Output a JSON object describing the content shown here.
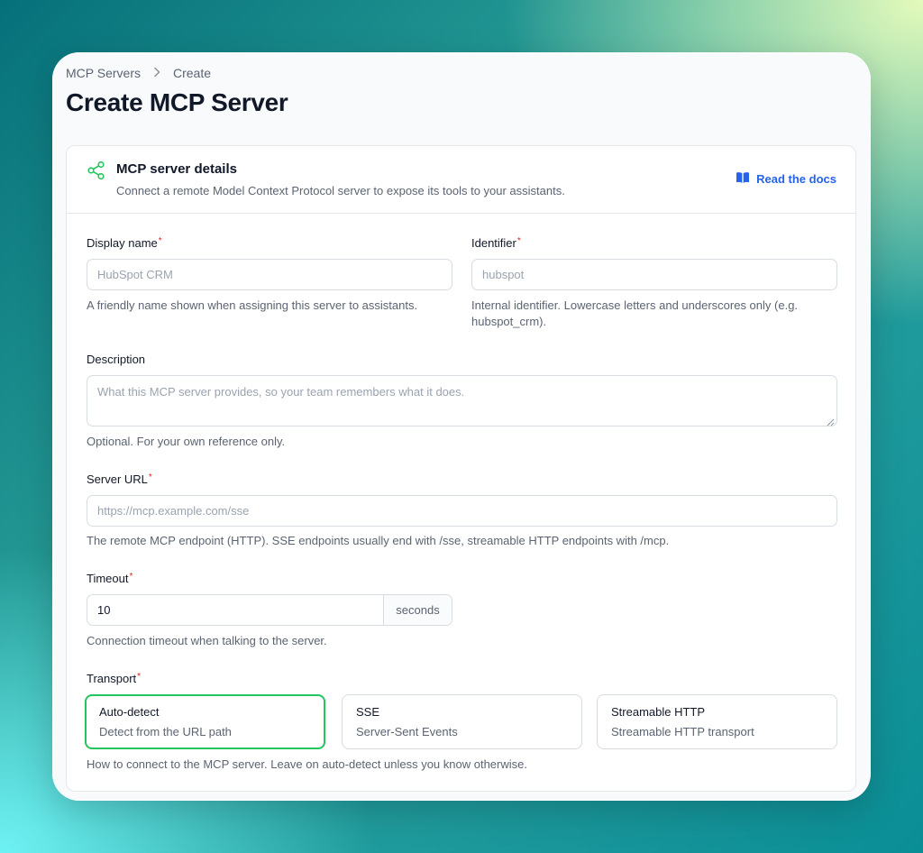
{
  "breadcrumb": {
    "parent": "MCP Servers",
    "current": "Create"
  },
  "page_title": "Create MCP Server",
  "card": {
    "title": "MCP server details",
    "subtitle": "Connect a remote Model Context Protocol server to expose its tools to your assistants.",
    "docs_link": "Read the docs",
    "icon": "share-nodes-icon"
  },
  "fields": {
    "display_name": {
      "label": "Display name",
      "required_mark": "*",
      "placeholder": "HubSpot CRM",
      "value": "",
      "help": "A friendly name shown when assigning this server to assistants."
    },
    "identifier": {
      "label": "Identifier",
      "required_mark": "*",
      "placeholder": "hubspot",
      "value": "",
      "help_line1": "Internal identifier. Lowercase letters and underscores only (e.g.",
      "help_line2": "hubspot_crm)."
    },
    "description": {
      "label": "Description",
      "placeholder": "What this MCP server provides, so your team remembers what it does.",
      "help": "Optional. For your own reference only."
    },
    "server_url": {
      "label": "Server URL",
      "required_mark": "*",
      "placeholder": "https://mcp.example.com/sse",
      "help": "The remote MCP endpoint (HTTP). SSE endpoints usually end with /sse, streamable HTTP endpoints with /mcp."
    },
    "timeout": {
      "label": "Timeout",
      "required_mark": "*",
      "value": "10",
      "unit": "seconds",
      "help": "Connection timeout when talking to the server."
    },
    "transport": {
      "label": "Transport",
      "required_mark": "*",
      "selected": "Auto-detect",
      "options": [
        {
          "title": "Auto-detect",
          "description": "Detect from the URL path"
        },
        {
          "title": "SSE",
          "description": "Server-Sent Events"
        },
        {
          "title": "Streamable HTTP",
          "description": "Streamable HTTP transport"
        }
      ],
      "help": "How to connect to the MCP server. Leave on auto-detect unless you know otherwise."
    }
  },
  "colors": {
    "accent_link": "#2563eb",
    "selected_border": "#22c55e",
    "required": "#dc2626",
    "icon_green": "#22c55e"
  }
}
